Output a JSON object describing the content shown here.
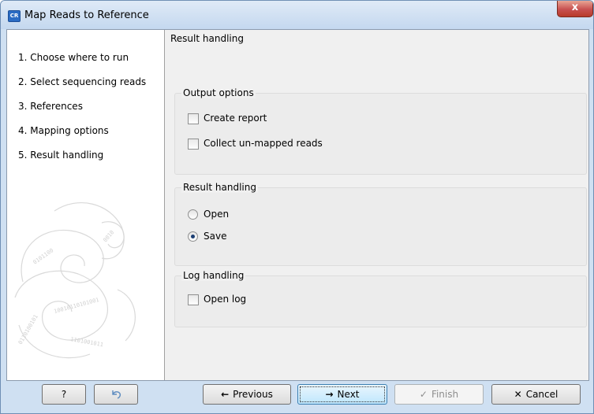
{
  "window": {
    "title": "Map Reads to Reference",
    "app_icon_text": "CR",
    "close_symbol": "x"
  },
  "sidebar": {
    "steps": [
      {
        "label": "1.  Choose where to run"
      },
      {
        "label": "2.  Select sequencing reads"
      },
      {
        "label": "3.  References"
      },
      {
        "label": "4.  Mapping options"
      },
      {
        "label": "5.  Result handling"
      }
    ]
  },
  "main": {
    "page_title": "Result handling",
    "output_options": {
      "label": "Output options",
      "create_report": {
        "label": "Create report",
        "checked": false
      },
      "collect_unmapped": {
        "label": "Collect un-mapped reads",
        "checked": false
      }
    },
    "result_handling": {
      "label": "Result handling",
      "open": {
        "label": "Open",
        "selected": false
      },
      "save": {
        "label": "Save",
        "selected": true
      }
    },
    "log_handling": {
      "label": "Log handling",
      "open_log": {
        "label": "Open log",
        "checked": false
      }
    }
  },
  "footer": {
    "help_label": "?",
    "reset_icon": "undo-icon",
    "previous_label": "Previous",
    "next_label": "Next",
    "finish_label": "Finish",
    "cancel_label": "Cancel"
  },
  "colors": {
    "title_bar": "#c4d8ef",
    "close_button": "#c75050",
    "focus_border": "#3c7fb1",
    "radio_dot": "#1b3e73"
  }
}
